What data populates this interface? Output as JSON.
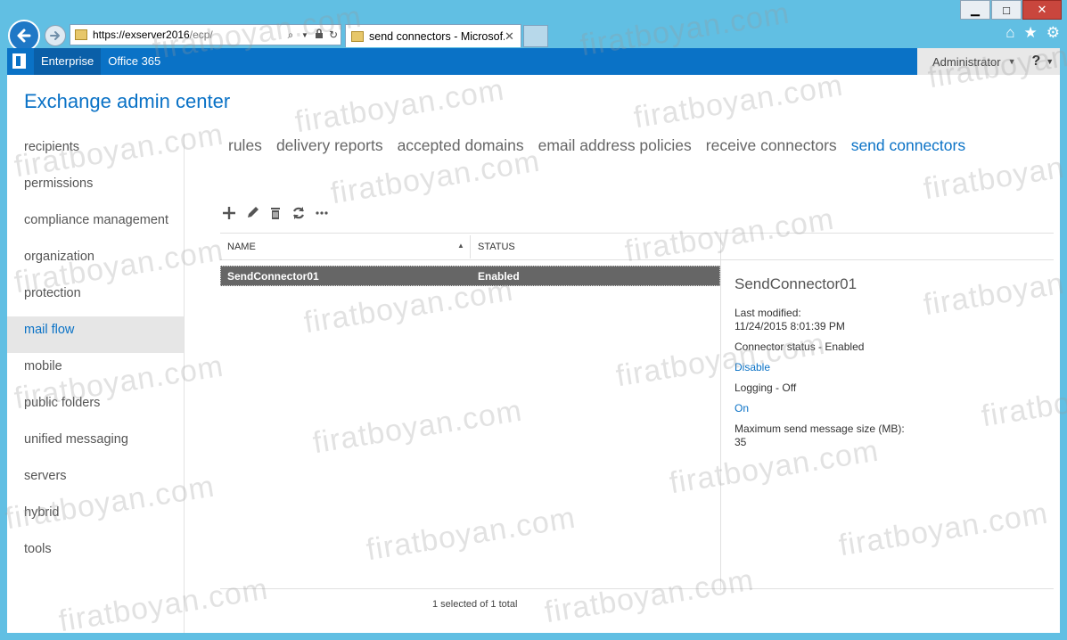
{
  "browser": {
    "window_buttons": {
      "minimize": "▁",
      "maximize": "□",
      "close": "✕"
    },
    "back_icon": "arrow-left",
    "forward_icon": "arrow-right",
    "address": {
      "host": "https://exserver2016",
      "path": "/ecp/"
    },
    "tab": {
      "title": "send connectors - Microsof...",
      "close": "✕"
    },
    "toolbar_icons": [
      "home-icon",
      "star-icon",
      "gear-icon"
    ]
  },
  "topbar": {
    "nav": [
      "Enterprise",
      "Office 365"
    ],
    "user": "Administrator",
    "help": "?"
  },
  "app_title": "Exchange admin center",
  "leftnav": [
    "recipients",
    "permissions",
    "compliance management",
    "organization",
    "protection",
    "mail flow",
    "mobile",
    "public folders",
    "unified messaging",
    "servers",
    "hybrid",
    "tools"
  ],
  "subnav": [
    "rules",
    "delivery reports",
    "accepted domains",
    "email address policies",
    "receive connectors",
    "send connectors"
  ],
  "grid": {
    "columns": [
      "NAME",
      "STATUS"
    ],
    "rows": [
      {
        "name": "SendConnector01",
        "status": "Enabled"
      }
    ]
  },
  "details": {
    "title": "SendConnector01",
    "last_modified_label": "Last modified:",
    "last_modified_value": "11/24/2015 8:01:39 PM",
    "connector_status": "Connector status - Enabled",
    "disable_link": "Disable",
    "logging": "Logging - Off",
    "on_link": "On",
    "max_size_label": "Maximum send message size (MB):",
    "max_size_value": "35"
  },
  "footer": "1 selected of 1 total",
  "watermark": "firatboyan.com",
  "colors": {
    "accent": "#0a72c6",
    "frame": "#61bfe3",
    "selected_row": "#666666"
  }
}
